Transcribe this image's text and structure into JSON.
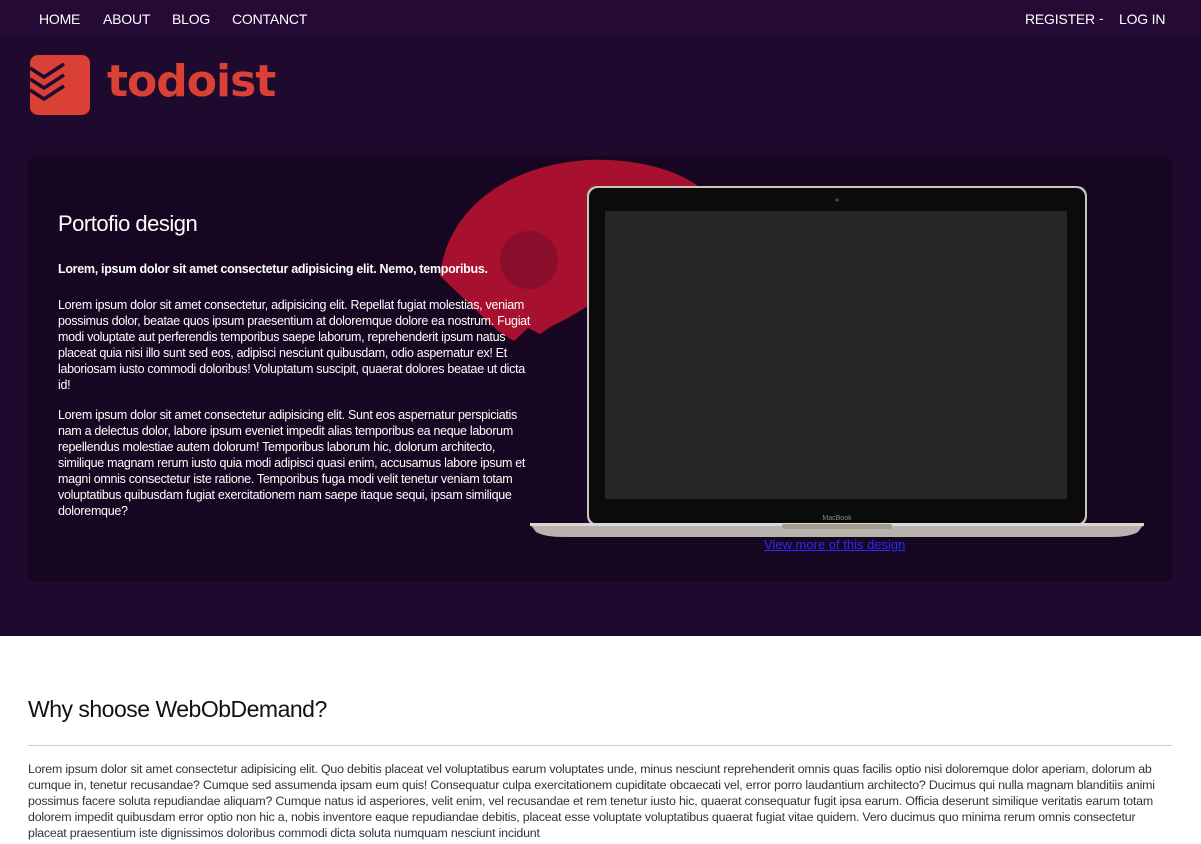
{
  "nav": {
    "left": [
      "HOME",
      "ABOUT",
      "BLOG",
      "CONTANCT"
    ],
    "register": "REGISTER",
    "separator": "-",
    "login": "LOG IN"
  },
  "brand": {
    "name": "todoist",
    "color": "#db4035",
    "icon": "todoist-logo-icon"
  },
  "hero": {
    "title": "Portofio design",
    "lead": "Lorem, ipsum dolor sit amet consectetur adipisicing elit. Nemo, temporibus.",
    "paragraphs": [
      "Lorem ipsum dolor sit amet consectetur, adipisicing elit. Repellat fugiat molestias, veniam possimus dolor, beatae quos ipsum praesentium at doloremque dolore ea nostrum. Fugiat modi voluptate aut perferendis temporibus saepe laborum, reprehenderit ipsum natus placeat quia nisi illo sunt sed eos, adipisci nesciunt quibusdam, odio aspernatur ex! Et laboriosam iusto commodi doloribus! Voluptatum suscipit, quaerat dolores beatae ut dicta id!",
      "Lorem ipsum dolor sit amet consectetur adipisicing elit. Sunt eos aspernatur perspiciatis nam a delectus dolor, labore ipsum eveniet impedit alias temporibus ea neque laborum repellendus molestiae autem dolorum! Temporibus laborum hic, dolorum architecto, similique magnam rerum iusto quia modi adipisci quasi enim, accusamus labore ipsum et magni omnis consectetur iste ratione. Temporibus fuga modi velit tenetur veniam totam voluptatibus quibusdam fugiat exercitationem nam saepe itaque sequi, ipsam similique doloremque?"
    ],
    "laptop_label": "MacBook",
    "link": "View more of this design"
  },
  "why": {
    "title": "Why shoose WebObDemand?",
    "text": "Lorem ipsum dolor sit amet consectetur adipisicing elit. Quo debitis placeat vel voluptatibus earum voluptates unde, minus nesciunt reprehenderit omnis quas facilis optio nisi doloremque dolor aperiam, dolorum ab cumque in, tenetur recusandae? Cumque sed assumenda ipsam eum quis! Consequatur culpa exercitationem cupiditate obcaecati vel, error porro laudantium architecto? Ducimus qui nulla magnam blanditiis animi possimus facere soluta repudiandae aliquam? Cumque natus id asperiores, velit enim, vel recusandae et rem tenetur iusto hic, quaerat consequatur fugit ipsa earum. Officia deserunt similique veritatis earum totam dolorem impedit quibusdam error optio non hic a, nobis inventore eaque repudiandae debitis, placeat esse voluptate voluptatibus quaerat fugiat vitae quidem. Vero ducimus quo minima rerum omnis consectetur placeat praesentium iste dignissimos doloribus commodi dicta soluta numquam nesciunt incidunt"
  },
  "colors": {
    "nav_bg": "#250a36",
    "hero_bg": "#1e0a2e",
    "card_bg": "#160621",
    "accent": "#a8102f",
    "link": "#2a2aff"
  }
}
